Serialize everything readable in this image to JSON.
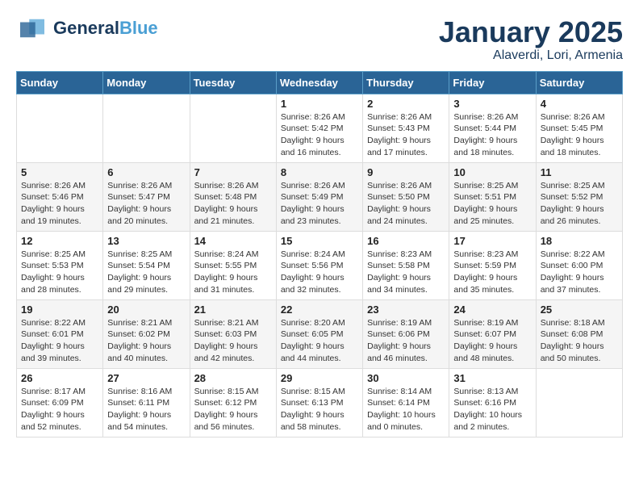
{
  "header": {
    "logo_general": "General",
    "logo_blue": "Blue",
    "title": "January 2025",
    "subtitle": "Alaverdi, Lori, Armenia"
  },
  "days_of_week": [
    "Sunday",
    "Monday",
    "Tuesday",
    "Wednesday",
    "Thursday",
    "Friday",
    "Saturday"
  ],
  "weeks": [
    [
      {
        "day": "",
        "content": ""
      },
      {
        "day": "",
        "content": ""
      },
      {
        "day": "",
        "content": ""
      },
      {
        "day": "1",
        "content": "Sunrise: 8:26 AM\nSunset: 5:42 PM\nDaylight: 9 hours and 16 minutes."
      },
      {
        "day": "2",
        "content": "Sunrise: 8:26 AM\nSunset: 5:43 PM\nDaylight: 9 hours and 17 minutes."
      },
      {
        "day": "3",
        "content": "Sunrise: 8:26 AM\nSunset: 5:44 PM\nDaylight: 9 hours and 18 minutes."
      },
      {
        "day": "4",
        "content": "Sunrise: 8:26 AM\nSunset: 5:45 PM\nDaylight: 9 hours and 18 minutes."
      }
    ],
    [
      {
        "day": "5",
        "content": "Sunrise: 8:26 AM\nSunset: 5:46 PM\nDaylight: 9 hours and 19 minutes."
      },
      {
        "day": "6",
        "content": "Sunrise: 8:26 AM\nSunset: 5:47 PM\nDaylight: 9 hours and 20 minutes."
      },
      {
        "day": "7",
        "content": "Sunrise: 8:26 AM\nSunset: 5:48 PM\nDaylight: 9 hours and 21 minutes."
      },
      {
        "day": "8",
        "content": "Sunrise: 8:26 AM\nSunset: 5:49 PM\nDaylight: 9 hours and 23 minutes."
      },
      {
        "day": "9",
        "content": "Sunrise: 8:26 AM\nSunset: 5:50 PM\nDaylight: 9 hours and 24 minutes."
      },
      {
        "day": "10",
        "content": "Sunrise: 8:25 AM\nSunset: 5:51 PM\nDaylight: 9 hours and 25 minutes."
      },
      {
        "day": "11",
        "content": "Sunrise: 8:25 AM\nSunset: 5:52 PM\nDaylight: 9 hours and 26 minutes."
      }
    ],
    [
      {
        "day": "12",
        "content": "Sunrise: 8:25 AM\nSunset: 5:53 PM\nDaylight: 9 hours and 28 minutes."
      },
      {
        "day": "13",
        "content": "Sunrise: 8:25 AM\nSunset: 5:54 PM\nDaylight: 9 hours and 29 minutes."
      },
      {
        "day": "14",
        "content": "Sunrise: 8:24 AM\nSunset: 5:55 PM\nDaylight: 9 hours and 31 minutes."
      },
      {
        "day": "15",
        "content": "Sunrise: 8:24 AM\nSunset: 5:56 PM\nDaylight: 9 hours and 32 minutes."
      },
      {
        "day": "16",
        "content": "Sunrise: 8:23 AM\nSunset: 5:58 PM\nDaylight: 9 hours and 34 minutes."
      },
      {
        "day": "17",
        "content": "Sunrise: 8:23 AM\nSunset: 5:59 PM\nDaylight: 9 hours and 35 minutes."
      },
      {
        "day": "18",
        "content": "Sunrise: 8:22 AM\nSunset: 6:00 PM\nDaylight: 9 hours and 37 minutes."
      }
    ],
    [
      {
        "day": "19",
        "content": "Sunrise: 8:22 AM\nSunset: 6:01 PM\nDaylight: 9 hours and 39 minutes."
      },
      {
        "day": "20",
        "content": "Sunrise: 8:21 AM\nSunset: 6:02 PM\nDaylight: 9 hours and 40 minutes."
      },
      {
        "day": "21",
        "content": "Sunrise: 8:21 AM\nSunset: 6:03 PM\nDaylight: 9 hours and 42 minutes."
      },
      {
        "day": "22",
        "content": "Sunrise: 8:20 AM\nSunset: 6:05 PM\nDaylight: 9 hours and 44 minutes."
      },
      {
        "day": "23",
        "content": "Sunrise: 8:19 AM\nSunset: 6:06 PM\nDaylight: 9 hours and 46 minutes."
      },
      {
        "day": "24",
        "content": "Sunrise: 8:19 AM\nSunset: 6:07 PM\nDaylight: 9 hours and 48 minutes."
      },
      {
        "day": "25",
        "content": "Sunrise: 8:18 AM\nSunset: 6:08 PM\nDaylight: 9 hours and 50 minutes."
      }
    ],
    [
      {
        "day": "26",
        "content": "Sunrise: 8:17 AM\nSunset: 6:09 PM\nDaylight: 9 hours and 52 minutes."
      },
      {
        "day": "27",
        "content": "Sunrise: 8:16 AM\nSunset: 6:11 PM\nDaylight: 9 hours and 54 minutes."
      },
      {
        "day": "28",
        "content": "Sunrise: 8:15 AM\nSunset: 6:12 PM\nDaylight: 9 hours and 56 minutes."
      },
      {
        "day": "29",
        "content": "Sunrise: 8:15 AM\nSunset: 6:13 PM\nDaylight: 9 hours and 58 minutes."
      },
      {
        "day": "30",
        "content": "Sunrise: 8:14 AM\nSunset: 6:14 PM\nDaylight: 10 hours and 0 minutes."
      },
      {
        "day": "31",
        "content": "Sunrise: 8:13 AM\nSunset: 6:16 PM\nDaylight: 10 hours and 2 minutes."
      },
      {
        "day": "",
        "content": ""
      }
    ]
  ]
}
